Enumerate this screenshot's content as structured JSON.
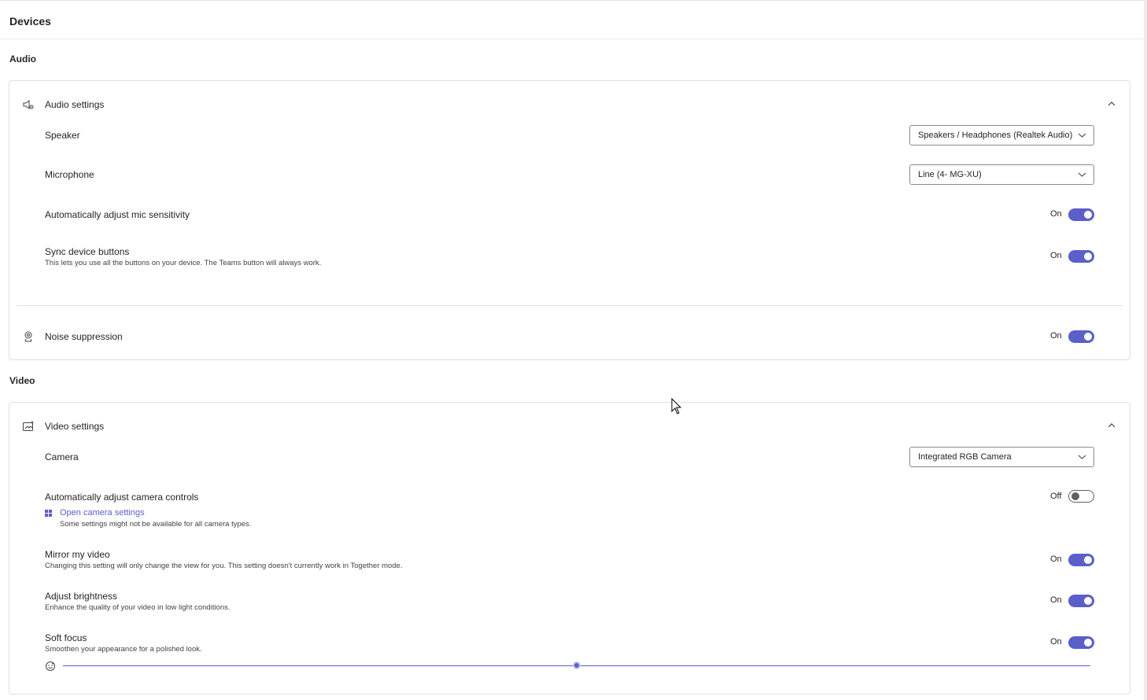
{
  "page": {
    "title": "Devices"
  },
  "audio": {
    "section_label": "Audio",
    "card_title": "Audio settings",
    "speaker": {
      "label": "Speaker",
      "value": "Speakers / Headphones (Realtek Audio)"
    },
    "microphone": {
      "label": "Microphone",
      "value": "Line (4- MG-XU)"
    },
    "auto_mic": {
      "label": "Automatically adjust mic sensitivity",
      "state": "On"
    },
    "sync_buttons": {
      "label": "Sync device buttons",
      "description": "This lets you use all the buttons on your device. The Teams button will always work.",
      "state": "On"
    },
    "noise_suppression": {
      "label": "Noise suppression",
      "state": "On"
    }
  },
  "video": {
    "section_label": "Video",
    "card_title": "Video settings",
    "camera": {
      "label": "Camera",
      "value": "Integrated RGB Camera"
    },
    "auto_camera": {
      "label": "Automatically adjust camera controls",
      "state": "Off",
      "link": "Open camera settings",
      "link_note": "Some settings might not be available for all camera types."
    },
    "mirror": {
      "label": "Mirror my video",
      "description": "Changing this setting will only change the view for you. This setting doesn't currently work in Together mode.",
      "state": "On"
    },
    "brightness": {
      "label": "Adjust brightness",
      "description": "Enhance the quality of your video in low light conditions.",
      "state": "On"
    },
    "soft_focus": {
      "label": "Soft focus",
      "description": "Smoothen your appearance for a polished look.",
      "state": "On",
      "slider_level": 0.5
    }
  },
  "icons": {
    "audio_settings": "speaker-gear-icon",
    "noise_suppression": "noise-suppression-icon",
    "video_settings": "video-settings-icon",
    "chevron": "chevron-up-icon",
    "dropdown": "chevron-down-icon",
    "windows": "windows-logo-icon",
    "soft_focus": "face-icon"
  },
  "colors": {
    "accent": "#5b5fc7",
    "text": "#242424",
    "border": "#e0e0e0"
  }
}
